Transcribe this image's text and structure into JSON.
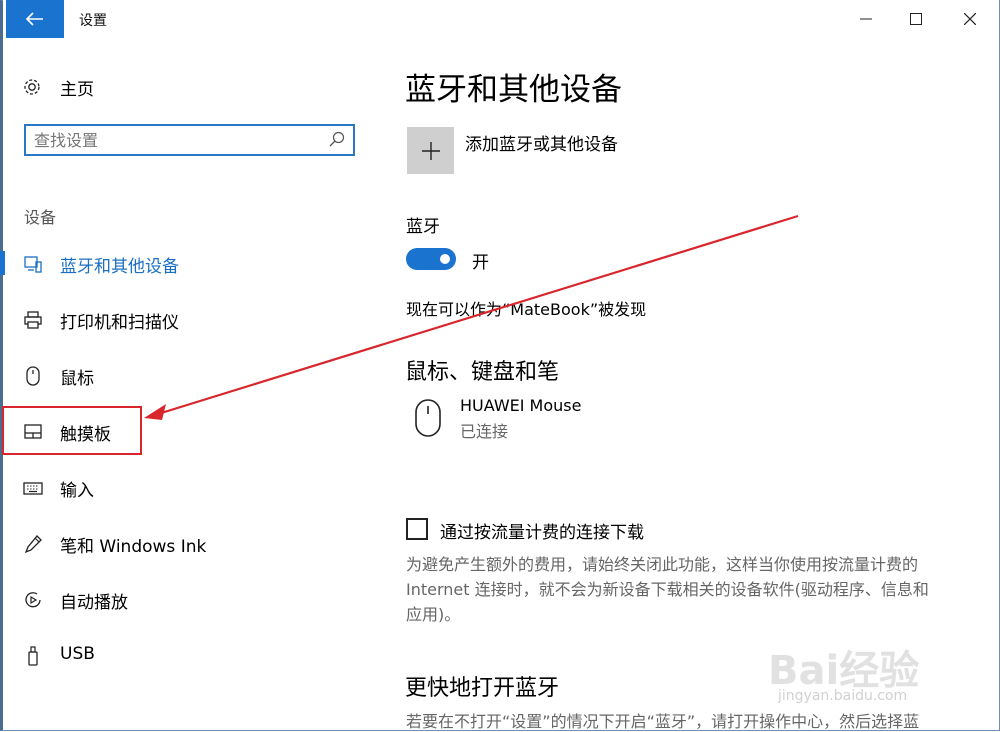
{
  "window": {
    "title": "设置"
  },
  "sidebar": {
    "home_label": "主页",
    "search_placeholder": "查找设置",
    "section_label": "设备",
    "items": [
      {
        "label": "蓝牙和其他设备",
        "icon": "bluetooth-devices-icon",
        "active": true
      },
      {
        "label": "打印机和扫描仪",
        "icon": "printer-icon",
        "active": false
      },
      {
        "label": "鼠标",
        "icon": "mouse-icon",
        "active": false
      },
      {
        "label": "触摸板",
        "icon": "touchpad-icon",
        "active": false
      },
      {
        "label": "输入",
        "icon": "keyboard-icon",
        "active": false
      },
      {
        "label": "笔和 Windows Ink",
        "icon": "pen-icon",
        "active": false
      },
      {
        "label": "自动播放",
        "icon": "autoplay-icon",
        "active": false
      },
      {
        "label": "USB",
        "icon": "usb-icon",
        "active": false
      }
    ]
  },
  "main": {
    "title": "蓝牙和其他设备",
    "add_device_label": "添加蓝牙或其他设备",
    "bluetooth_label": "蓝牙",
    "bluetooth_state": "开",
    "discoverable_text": "现在可以作为“MateBook”被发现",
    "mouse_section_title": "鼠标、键盘和笔",
    "device": {
      "name": "HUAWEI  Mouse",
      "status": "已连接"
    },
    "metered_label": "通过按流量计费的连接下载",
    "metered_desc": "为避免产生额外的费用，请始终关闭此功能，这样当你使用按流量计费的 Internet 连接时，就不会为新设备下载相关的设备软件(驱动程序、信息和应用)。",
    "quick_section_title": "更快地打开蓝牙",
    "quick_desc": "若要在不打开“设置”的情况下开启“蓝牙”，请打开操作中心，然后选择蓝"
  },
  "watermark": {
    "brand": "Bai经验",
    "url": "jingyan.baidu.com"
  },
  "colors": {
    "accent": "#1a73cf",
    "annotation": "#d9262c"
  }
}
